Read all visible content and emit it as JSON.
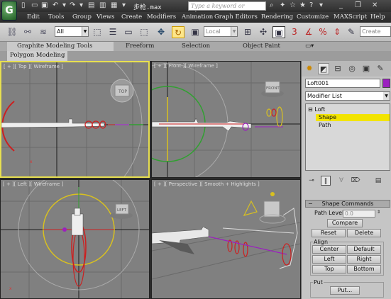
{
  "app": {
    "logo": "G",
    "window_title": "步枪.max",
    "search_placeholder": "Type a keyword or phrase"
  },
  "menus": [
    "Edit",
    "Tools",
    "Group",
    "Views",
    "Create",
    "Modifiers",
    "Animation",
    "Graph Editors",
    "Rendering",
    "Customize",
    "MAXScript",
    "Help"
  ],
  "toolbar": {
    "selection_filter": "All",
    "ref_coord": "Local",
    "create_sel": "Create"
  },
  "ribbon": {
    "tabs": [
      "Graphite Modeling Tools",
      "Freeform",
      "Selection",
      "Object Paint"
    ],
    "subtab": "Polygon Modeling"
  },
  "viewports": {
    "top": {
      "label": "[ + ][ Top ][ Wireframe ]",
      "cube": "TOP"
    },
    "front": {
      "label": "[ + ][ Front ][ Wireframe ]",
      "cube": "FRONT"
    },
    "left": {
      "label": "[ + ][ Left ][ Wireframe ]",
      "cube": "LEFT"
    },
    "persp": {
      "label": "[ + ][ Perspective ][ Smooth + Highlights ]"
    }
  },
  "panel": {
    "object_name": "Loft001",
    "color": "#9b1fbf",
    "modifier_list": "Modifier List",
    "stack": {
      "root": "Loft",
      "items": [
        "Shape",
        "Path"
      ],
      "selected": "Shape"
    },
    "rollout_title": "Shape Commands",
    "path_level_label": "Path Level:",
    "path_level_value": "0.0",
    "compare": "Compare",
    "reset": "Reset",
    "delete": "Delete",
    "align_label": "Align",
    "center": "Center",
    "default": "Default",
    "left": "Left",
    "right": "Right",
    "top": "Top",
    "bottom": "Bottom",
    "put_label": "Put",
    "put_button": "Put..."
  },
  "colors": {
    "active_border": "#e8e050",
    "selected_item": "#f2e400",
    "viewport_bg": "#808080"
  }
}
